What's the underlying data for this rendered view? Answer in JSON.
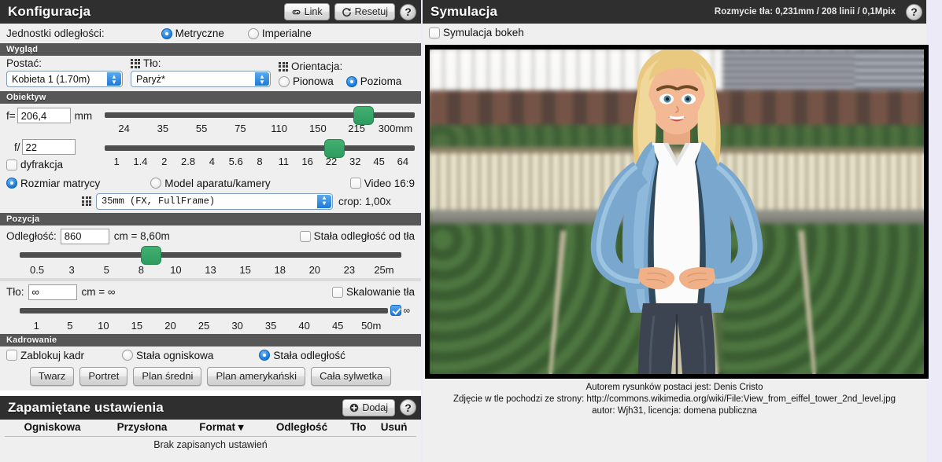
{
  "config": {
    "title": "Konfiguracja",
    "link_button": "Link",
    "reset_button": "Resetuj",
    "help": "?",
    "units_label": "Jednostki odległości:",
    "units_metric": "Metryczne",
    "units_imperial": "Imperialne",
    "units_selected": "Metryczne"
  },
  "appearance": {
    "section": "Wygląd",
    "character_label": "Postać:",
    "character_value": "Kobieta 1 (1.70m)",
    "background_label": "Tło:",
    "background_value": "Paryż*",
    "orientation_label": "Orientacja:",
    "orientation_portrait": "Pionowa",
    "orientation_landscape": "Pozioma",
    "orientation_selected": "Pozioma"
  },
  "lens": {
    "section": "Obiektyw",
    "focal_prefix": "f=",
    "focal_value": "206,4",
    "focal_unit": "mm",
    "focal_ticks": [
      "24",
      "35",
      "55",
      "75",
      "110",
      "150",
      "215",
      "300mm"
    ],
    "focal_thumb_pct": 83.5,
    "aperture_prefix": "f/",
    "aperture_value": "22",
    "diffraction_label": "dyfrakcja",
    "diffraction_checked": false,
    "aperture_ticks": [
      "1",
      "1.4",
      "2",
      "2.8",
      "4",
      "5.6",
      "8",
      "11",
      "16",
      "22",
      "32",
      "45",
      "64"
    ],
    "aperture_thumb_pct": 74.0,
    "sensor_size_label": "Rozmiar matrycy",
    "camera_model_label": "Model aparatu/kamery",
    "video_label": "Video 16:9",
    "video_checked": false,
    "mode_selected": "Rozmiar matrycy",
    "sensor_value": "35mm (FX, FullFrame)",
    "crop_label": "crop: 1,00x"
  },
  "position": {
    "section": "Pozycja",
    "distance_label": "Odległość:",
    "distance_value": "860",
    "distance_suffix": "cm = 8,60m",
    "fixed_bg_label": "Stała odległość od tła",
    "fixed_bg_checked": false,
    "distance_ticks": [
      "0.5",
      "3",
      "5",
      "8",
      "10",
      "13",
      "15",
      "18",
      "20",
      "23",
      "25m"
    ],
    "distance_thumb_pct": 34.5,
    "bg_label": "Tło:",
    "bg_value": "∞",
    "bg_suffix": "cm = ∞",
    "bg_scaling_label": "Skalowanie tła",
    "bg_scaling_checked": false,
    "bg_ticks": [
      "1",
      "5",
      "10",
      "15",
      "20",
      "25",
      "30",
      "35",
      "40",
      "45",
      "50m"
    ],
    "bg_infinity_label": "∞",
    "bg_infinity_checked": true
  },
  "framing": {
    "section": "Kadrowanie",
    "lock_frame_label": "Zablokuj kadr",
    "lock_frame_checked": false,
    "fixed_focal_label": "Stała ogniskowa",
    "fixed_distance_label": "Stała odległość",
    "mode_selected": "Stała odległość",
    "presets": [
      "Twarz",
      "Portret",
      "Plan średni",
      "Plan amerykański",
      "Cała sylwetka"
    ]
  },
  "saved": {
    "title": "Zapamiętane ustawienia",
    "add_button": "Dodaj",
    "help": "?",
    "columns": [
      "Ogniskowa",
      "Przysłona",
      "Format ▾",
      "Odległość",
      "Tło",
      "Usuń"
    ],
    "empty_message": "Brak zapisanych ustawień",
    "rows": []
  },
  "simulation": {
    "title": "Symulacja",
    "blur_info": "Rozmycie tła: 0,231mm / 208 linii / 0,1Mpix",
    "help": "?",
    "bokeh_label": "Symulacja bokeh",
    "bokeh_checked": false,
    "credit_line_1": "Autorem rysunków postaci jest: Denis Cristo",
    "credit_line_2": "Zdjęcie w tle pochodzi ze strony: http://commons.wikimedia.org/wiki/File:View_from_eiffel_tower_2nd_level.jpg",
    "credit_line_3": "autor: Wjh31, licencja: domena publiczna"
  },
  "colors": {
    "accent": "#1878d6",
    "slider_thumb": "#35a367",
    "panel_header": "#2f2f2f",
    "section_header": "#575757"
  }
}
